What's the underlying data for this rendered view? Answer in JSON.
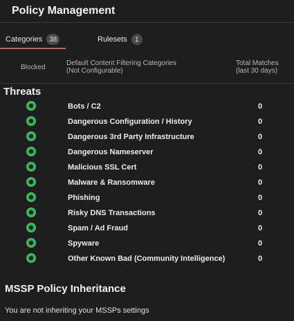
{
  "page": {
    "title": "Policy Management"
  },
  "tabs": [
    {
      "label": "Categories",
      "badge": "38"
    },
    {
      "label": "Rulesets",
      "badge": "1"
    }
  ],
  "columns": {
    "blocked": "Blocked",
    "category_line1": "Default Content Filtering Categories",
    "category_line2": "(Not Configurable)",
    "matches_line1": "Total Matches",
    "matches_line2": "(last 30 days)"
  },
  "threats": {
    "heading": "Threats",
    "rows": [
      {
        "label": "Bots / C2",
        "count": "0"
      },
      {
        "label": "Dangerous Configuration / History",
        "count": "0"
      },
      {
        "label": "Dangerous 3rd Party Infrastructure",
        "count": "0"
      },
      {
        "label": "Dangerous Nameserver",
        "count": "0"
      },
      {
        "label": "Malicious SSL Cert",
        "count": "0"
      },
      {
        "label": "Malware & Ransomware",
        "count": "0"
      },
      {
        "label": "Phishing",
        "count": "0"
      },
      {
        "label": "Risky DNS Transactions",
        "count": "0"
      },
      {
        "label": "Spam / Ad Fraud",
        "count": "0"
      },
      {
        "label": "Spyware",
        "count": "0"
      },
      {
        "label": "Other Known Bad (Community Intelligence)",
        "count": "0"
      }
    ]
  },
  "mssp": {
    "heading": "MSSP Policy Inheritance",
    "text": "You are not inheriting your MSSPs settings"
  },
  "colors": {
    "background": "#1e1e1e",
    "active_tab_underline": "#d75a4a",
    "toggle_on": "#2ea44f"
  },
  "icons": {
    "blocked_toggle": "toggle-on-icon"
  }
}
